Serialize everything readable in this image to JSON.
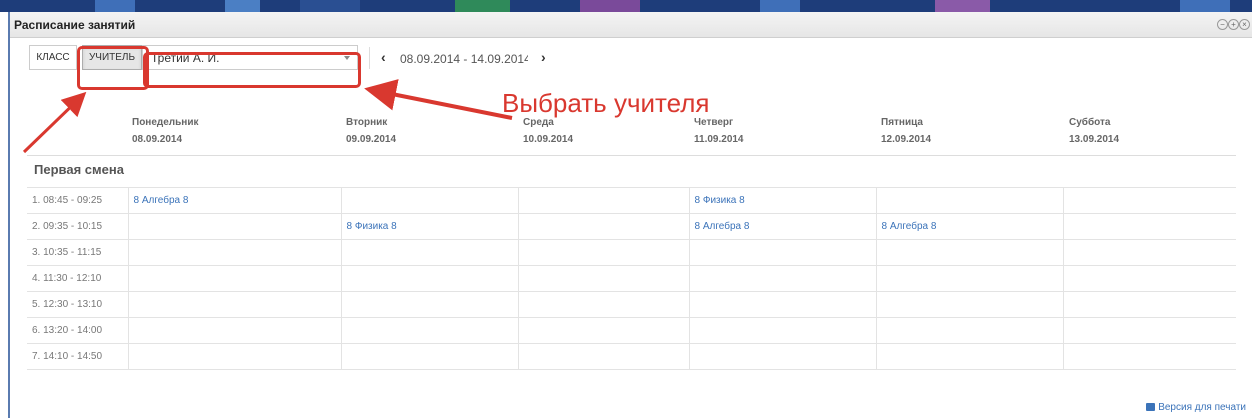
{
  "window": {
    "title": "Расписание занятий",
    "controls": [
      "−",
      "+",
      "×"
    ]
  },
  "toolbar": {
    "class_label": "КЛАСС",
    "teacher_label": "УЧИТЕЛЬ",
    "teacher_select_value": "Третий А. И.",
    "prev_icon": "‹",
    "next_icon": "›",
    "date_range": "08.09.2014 - 14.09.2014"
  },
  "annotation": {
    "text": "Выбрать учителя",
    "color": "#d9382f"
  },
  "days": [
    {
      "name": "Понедельник",
      "date": "08.09.2014"
    },
    {
      "name": "Вторник",
      "date": "09.09.2014"
    },
    {
      "name": "Среда",
      "date": "10.09.2014"
    },
    {
      "name": "Четверг",
      "date": "11.09.2014"
    },
    {
      "name": "Пятница",
      "date": "12.09.2014"
    },
    {
      "name": "Суббота",
      "date": "13.09.2014"
    }
  ],
  "shift": "Первая смена",
  "periods": [
    {
      "time": "1. 08:45 - 09:25",
      "cells": [
        "8 Алгебра 8",
        "",
        "",
        "8 Физика 8",
        "",
        ""
      ]
    },
    {
      "time": "2. 09:35 - 10:15",
      "cells": [
        "",
        "8 Физика 8",
        "",
        "8 Алгебра 8",
        "8 Алгебра 8",
        ""
      ]
    },
    {
      "time": "3. 10:35 - 11:15",
      "cells": [
        "",
        "",
        "",
        "",
        "",
        ""
      ]
    },
    {
      "time": "4. 11:30 - 12:10",
      "cells": [
        "",
        "",
        "",
        "",
        "",
        ""
      ]
    },
    {
      "time": "5. 12:30 - 13:10",
      "cells": [
        "",
        "",
        "",
        "",
        "",
        ""
      ]
    },
    {
      "time": "6. 13:20 - 14:00",
      "cells": [
        "",
        "",
        "",
        "",
        "",
        ""
      ]
    },
    {
      "time": "7. 14:10 - 14:50",
      "cells": [
        "",
        "",
        "",
        "",
        "",
        ""
      ]
    }
  ],
  "footer": {
    "print_label": "Версия для печати",
    "print_icon": "printer-icon"
  },
  "colors": {
    "link": "#3b73b9",
    "annotation": "#d9382f",
    "header_bg": "#1e3d7a"
  }
}
